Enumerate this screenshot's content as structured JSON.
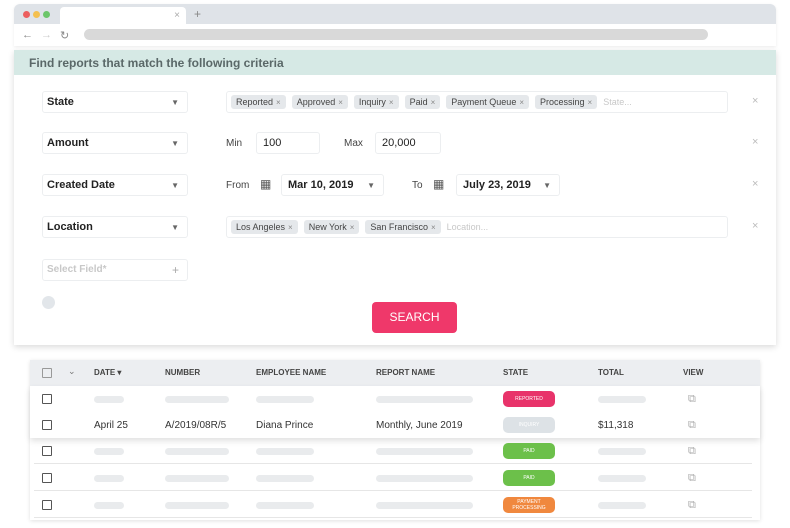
{
  "browser": {
    "tab_close": "×",
    "new_tab": "+",
    "back": "←",
    "forward": "→",
    "reload": "↻"
  },
  "panel": {
    "title": "Find reports that match the following criteria"
  },
  "filters": {
    "state": {
      "field": "State",
      "chips": [
        "Reported",
        "Approved",
        "Inquiry",
        "Paid",
        "Payment Queue",
        "Processing"
      ],
      "placeholder": "State..."
    },
    "amount": {
      "field": "Amount",
      "min_label": "Min",
      "min": "100",
      "max_label": "Max",
      "max": "20,000"
    },
    "date": {
      "field": "Created Date",
      "from_label": "From",
      "from": "Mar 10, 2019",
      "to_label": "To",
      "to": "July 23, 2019"
    },
    "location": {
      "field": "Location",
      "chips": [
        "Los Angeles",
        "New York",
        "San Francisco"
      ],
      "placeholder": "Location..."
    },
    "new_field": {
      "placeholder": "Select Field*"
    },
    "remove": "×",
    "chip_remove": "×",
    "add": "+"
  },
  "search_label": "SEARCH",
  "table": {
    "headers": {
      "date": "DATE",
      "number": "NUMBER",
      "employee": "EMPLOYEE NAME",
      "report": "REPORT NAME",
      "state": "STATE",
      "total": "TOTAL",
      "view": "VIEW"
    },
    "rows": [
      {
        "state": "REPORTED",
        "color": "#e8336a"
      },
      {
        "date": "April 25",
        "number": "A/2019/08R/5",
        "employee": "Diana Prince",
        "report": "Monthly, June 2019",
        "state": "INQUIRY",
        "total": "$11,318",
        "color": "#dde2e6"
      },
      {
        "state": "PAID",
        "color": "#6cc04a"
      },
      {
        "state": "PAID",
        "color": "#6cc04a"
      },
      {
        "state": "PAYMENT PROCESSING",
        "color": "#f0883e"
      }
    ]
  }
}
